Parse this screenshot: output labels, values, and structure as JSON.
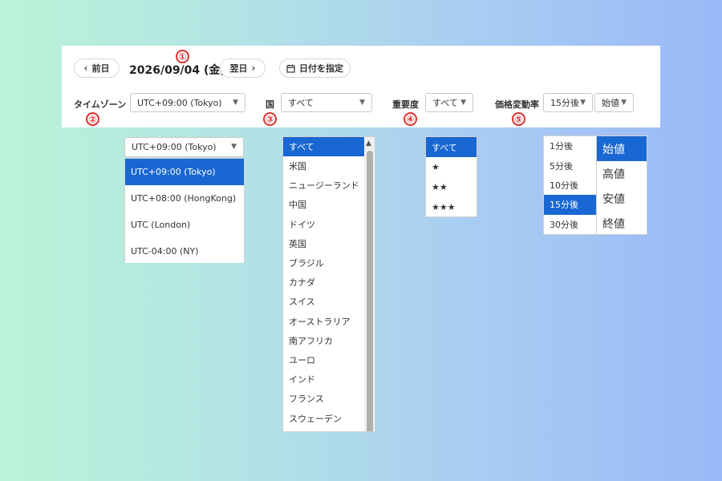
{
  "header": {
    "prev_label": "前日",
    "prev_icon": "chevron-left-icon",
    "date": "2026/09/04 (金)",
    "next_label": "翌日",
    "next_icon": "chevron-right-icon",
    "pick_date_label": "日付を指定",
    "calendar_icon": "calendar-icon"
  },
  "markers": [
    "①",
    "②",
    "③",
    "④",
    "⑤"
  ],
  "filters": {
    "timezone": {
      "label": "タイムゾーン",
      "value": "UTC+09:00 (Tokyo)"
    },
    "country": {
      "label": "国",
      "value": "すべて"
    },
    "importance": {
      "label": "重要度",
      "value": "すべて"
    },
    "price_change": {
      "label": "価格変動率",
      "time_value": "15分後",
      "price_value": "始値"
    }
  },
  "timezone_dropdown": {
    "current": "UTC+09:00 (Tokyo)",
    "options": [
      "UTC+09:00 (Tokyo)",
      "UTC+08:00 (HongKong)",
      "UTC (London)",
      "UTC-04:00 (NY)"
    ],
    "selected_index": 0
  },
  "country_dropdown": {
    "options": [
      "すべて",
      "米国",
      "ニュージーランド",
      "中国",
      "ドイツ",
      "英国",
      "ブラジル",
      "カナダ",
      "スイス",
      "オーストラリア",
      "南アフリカ",
      "ユーロ",
      "インド",
      "フランス",
      "スウェーデン"
    ],
    "selected_index": 0
  },
  "importance_dropdown": {
    "options": [
      "すべて",
      "★",
      "★★",
      "★★★"
    ],
    "selected_index": 0
  },
  "time_dropdown": {
    "options": [
      "1分後",
      "5分後",
      "10分後",
      "15分後",
      "30分後"
    ],
    "selected_index": 3
  },
  "price_dropdown": {
    "options": [
      "始値",
      "高値",
      "安値",
      "終値"
    ],
    "selected_index": 0
  },
  "colors": {
    "accent": "#1967d2",
    "marker": "#e23030"
  }
}
